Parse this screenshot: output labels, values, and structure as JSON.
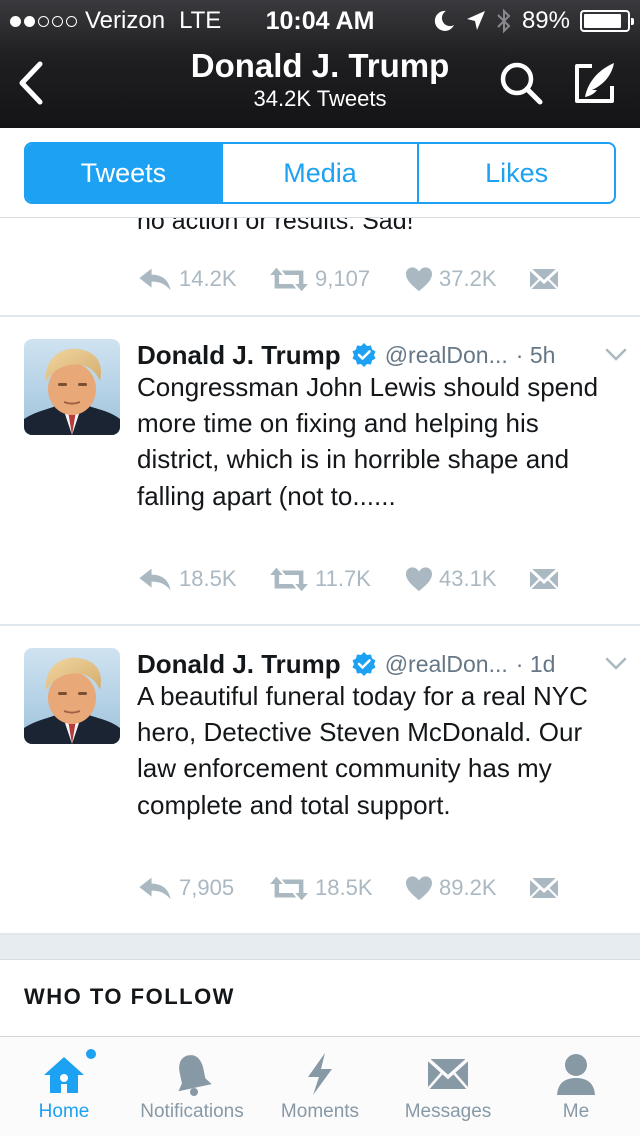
{
  "status_bar": {
    "carrier": "Verizon",
    "network": "LTE",
    "time": "10:04 AM",
    "battery": "89%",
    "battery_level": 0.89
  },
  "header": {
    "title": "Donald J. Trump",
    "subtitle": "34.2K Tweets"
  },
  "tabs": [
    {
      "label": "Tweets",
      "active": true
    },
    {
      "label": "Media",
      "active": false
    },
    {
      "label": "Likes",
      "active": false
    }
  ],
  "partial_tweet": {
    "text": "no action or results. Sad!",
    "replies": "14.2K",
    "retweets": "9,107",
    "likes": "37.2K"
  },
  "tweets": [
    {
      "name": "Donald J. Trump",
      "handle": "@realDon...",
      "time": "· 5h",
      "text": "Congressman John Lewis should spend more time on fixing and helping his district, which is in horrible shape and falling apart (not to......",
      "replies": "18.5K",
      "retweets": "11.7K",
      "likes": "43.1K"
    },
    {
      "name": "Donald J. Trump",
      "handle": "@realDon...",
      "time": "· 1d",
      "text": "A beautiful funeral today for a real NYC hero, Detective Steven McDonald. Our law enforcement community has my complete and total support.",
      "replies": "7,905",
      "retweets": "18.5K",
      "likes": "89.2K"
    }
  ],
  "who_to_follow": {
    "title": "WHO TO FOLLOW"
  },
  "tabbar": [
    {
      "label": "Home",
      "icon": "home-icon",
      "active": true
    },
    {
      "label": "Notifications",
      "icon": "bell-icon",
      "active": false
    },
    {
      "label": "Moments",
      "icon": "lightning-icon",
      "active": false
    },
    {
      "label": "Messages",
      "icon": "envelope-icon",
      "active": false
    },
    {
      "label": "Me",
      "icon": "person-icon",
      "active": false
    }
  ],
  "colors": {
    "accent": "#1da1f2",
    "header_bg": "#1f1f22",
    "muted": "#aab8c2"
  }
}
